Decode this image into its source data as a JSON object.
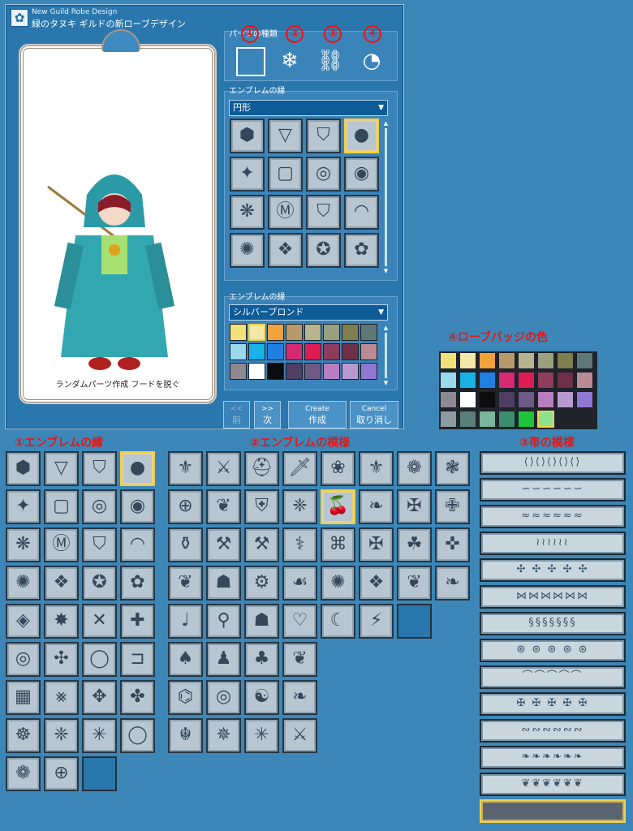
{
  "window": {
    "title_en": "New Guild Robe Design",
    "title_jp": "緑のタヌキ ギルドの新ローブデザイン"
  },
  "preview": {
    "caption": "ランダムパーツ作成 フードを脱ぐ"
  },
  "parts": {
    "label": "パーツの種類",
    "types": [
      {
        "num": "①",
        "icon": "frame-icon",
        "glyph": "▢"
      },
      {
        "num": "②",
        "icon": "snowflake-pattern-icon",
        "glyph": "❄"
      },
      {
        "num": "③",
        "icon": "band-icon",
        "glyph": "⛓"
      },
      {
        "num": "④",
        "icon": "palette-icon",
        "glyph": "◔"
      }
    ]
  },
  "emblem_border": {
    "label": "エンブレムの縁",
    "shape_value": "円形",
    "tiles": [
      "⬢",
      "▽",
      "⛉",
      "●",
      "✦",
      "▢",
      "◎",
      "◉",
      "❋",
      "Ⓜ",
      "⛉",
      "◠",
      "✺",
      "❖",
      "✪",
      "✿"
    ]
  },
  "emblem_color": {
    "label": "エンブレムの縁",
    "color_value": "シルバーブロンド",
    "colors": [
      "#f2e07a",
      "#f3e8a8",
      "#f2a23a",
      "#b89a6a",
      "#b8b48e",
      "#9aa07e",
      "#7e7e4e",
      "#5e7878",
      "#9ad8ee",
      "#18b2e6",
      "#1f80e2",
      "#d42a72",
      "#dc1c52",
      "#8e3c5a",
      "#6e3048",
      "#b88c92",
      "#8e8890",
      "#ffffff",
      "#0c0c0e",
      "#4e3f62",
      "#6e5a84",
      "#b87ec0",
      "#b89ad2",
      "#8e78d2"
    ]
  },
  "buttons": {
    "prev": {
      "en": "<<",
      "jp": "前"
    },
    "next": {
      "en": ">>",
      "jp": "次"
    },
    "create": {
      "en": "Create",
      "jp": "作成"
    },
    "cancel": {
      "en": "Cancel",
      "jp": "取り消し"
    }
  },
  "badge_colors": {
    "heading": "④ローブバッジの色",
    "colors": [
      "#f2e07a",
      "#f3e8a8",
      "#f2a23a",
      "#b89a6a",
      "#b8b48e",
      "#9aa07e",
      "#7e7e4e",
      "#5e7878",
      "#9ad8ee",
      "#18b2e6",
      "#1f80e2",
      "#d42a72",
      "#dc1c52",
      "#8e3c5a",
      "#6e3048",
      "#b88c92",
      "#8e8890",
      "#ffffff",
      "#0c0c0e",
      "#4e3f62",
      "#6e5a84",
      "#b87ec0",
      "#b89ad2",
      "#8e78d2",
      "#8e9aa0",
      "#5a7e7a",
      "#7ab49a",
      "#3a8e6e",
      "#20c43c",
      "#8ee28e"
    ]
  },
  "sections": {
    "border_heading": "①エンブレムの縁",
    "pattern_heading": "②エンブレムの模様",
    "band_heading": "③帯の模様"
  },
  "border_tiles": [
    "⬢",
    "▽",
    "⛉",
    "●",
    "✦",
    "▢",
    "◎",
    "◉",
    "❋",
    "Ⓜ",
    "⛉",
    "◠",
    "✺",
    "❖",
    "✪",
    "✿",
    "◈",
    "✸",
    "✕",
    "✚",
    "◎",
    "✣",
    "◯",
    "⊐",
    "▦",
    "⨳",
    "✥",
    "✤",
    "☸",
    "❈",
    "✳",
    "◯",
    "❁",
    "⊕",
    ""
  ],
  "pattern_tiles": [
    "⚜",
    "⚔",
    "⛑",
    "🗡",
    "❀",
    "⚜",
    "❁",
    "❃",
    "⊕",
    "❦",
    "⛨",
    "❈",
    "🍒",
    "❧",
    "✠",
    "✙",
    "⚱",
    "⚒",
    "⚒",
    "⚕",
    "⌘",
    "✠",
    "☘",
    "✜",
    "❦",
    "☗",
    "⚙",
    "☙",
    "✺",
    "❖",
    "❦",
    "❧",
    "♩",
    "⚲",
    "☗",
    "♡",
    "☾",
    "⚡",
    "",
    "♠",
    "♟",
    "♣",
    "❦",
    "⌬",
    "◎",
    "☯",
    "❧",
    "☬",
    "✵",
    "✳",
    "⚔"
  ],
  "band_tiles": [
    "⟨⟩⟨⟩⟨⟩⟨⟩⟨⟩",
    "∽∽∽∽∽∽",
    "≈≈≈≈≈≈",
    "≀≀≀≀≀≀",
    "✣ ✣ ✣ ✣ ✣",
    "⋈⋈⋈⋈⋈⋈",
    "§§§§§§§",
    "⊛ ⊛ ⊛ ⊛ ⊛",
    "⌒⌒⌒⌒⌒",
    "✠ ✠ ✠ ✠ ✠",
    "∾∾∾∾∾∾",
    "❧❧❧❧❧❧",
    "❦❦❦❦❦❦",
    ""
  ]
}
